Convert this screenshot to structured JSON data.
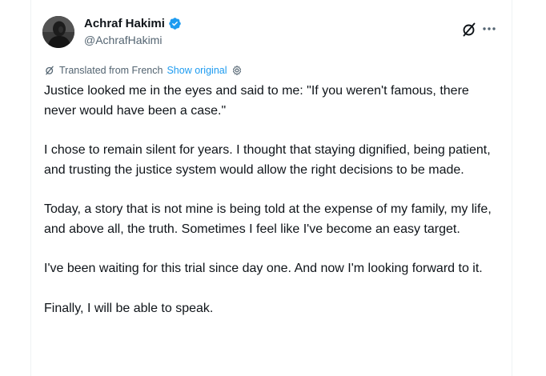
{
  "author": {
    "display_name": "Achraf Hakimi",
    "handle": "@AchrafHakimi",
    "verified": true
  },
  "header_actions": {
    "grok_icon": "grok-slash-circle-icon",
    "more_icon": "more-horizontal-icon"
  },
  "translation": {
    "label": "Translated from French",
    "show_original": "Show original",
    "settings_icon": "gear-icon"
  },
  "tweet": {
    "paragraphs": [
      "Justice looked me in the eyes and said to me: \"If you weren't famous, there never would have been a case.\"",
      "I chose to remain silent for years. I thought that staying dignified, being patient, and trusting the justice system would allow the right decisions to be made.",
      "Today, a story that is not mine is being told at the expense of my family, my life, and above all, the truth. Sometimes I feel like I've become an easy target.",
      "I've been waiting for this trial since day one. And now I'm looking forward to it.",
      "Finally, I will be able to speak."
    ]
  },
  "colors": {
    "text_primary": "#0f1419",
    "text_secondary": "#536471",
    "link": "#1d9bf0",
    "verified_badge": "#1d9bf0"
  }
}
